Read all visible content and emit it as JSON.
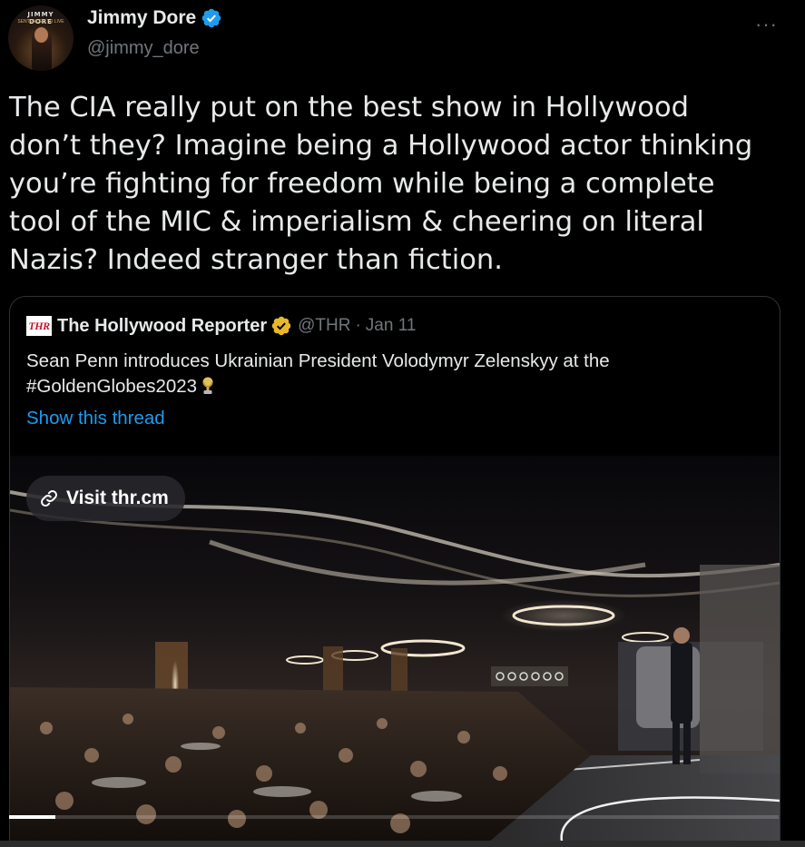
{
  "author": {
    "display_name": "Jimmy Dore",
    "handle": "@jimmy_dore",
    "avatar_text": "JIMMY DORE",
    "avatar_subtext": "SENTENCED TO LIVE",
    "verified": true,
    "verified_color": "#1d9bf0"
  },
  "tweet": {
    "text": "The CIA really put on the best show in Hollywood\ndon’t they? Imagine being a Hollywood actor thinking\nyou’re fighting for freedom while being a complete\ntool of the MIC & imperialism &  cheering on literal\nNazis? Indeed stranger than fiction."
  },
  "menu": {
    "more_icon": "more-horizontal-icon",
    "more_label": "···"
  },
  "quote": {
    "logo_text": "THR",
    "display_name": "The Hollywood Reporter",
    "verified_color": "#e8b829",
    "handle": "@THR",
    "separator": "·",
    "date": "Jan 11",
    "text": "Sean Penn introduces Ukrainian President Volodymyr Zelenskyy at the #GoldenGlobes2023",
    "trophy_icon": "golden-globe-icon",
    "show_thread": "Show this thread"
  },
  "media": {
    "visit_label": "Visit thr.cm",
    "link_icon": "link-icon",
    "progress": 0.06
  },
  "colors": {
    "background": "#000000",
    "text": "#e7e9ea",
    "muted": "#71767b",
    "accent": "#1d9bf0"
  }
}
